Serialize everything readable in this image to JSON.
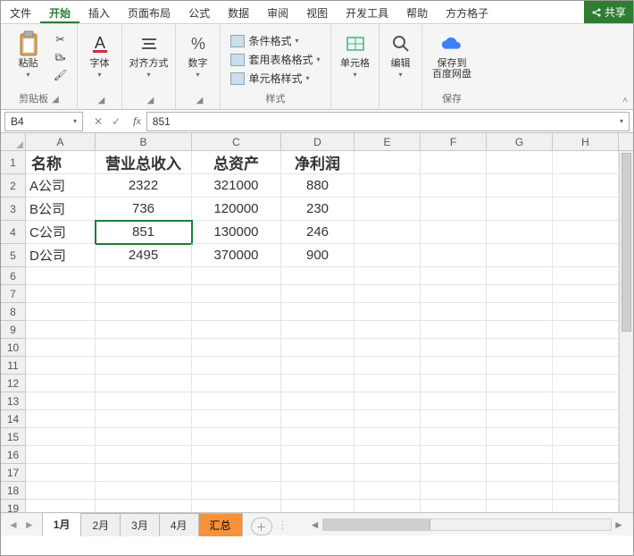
{
  "menu": {
    "items": [
      "文件",
      "开始",
      "插入",
      "页面布局",
      "公式",
      "数据",
      "审阅",
      "视图",
      "开发工具",
      "帮助",
      "方方格子"
    ],
    "active_index": 1,
    "share": "共享"
  },
  "ribbon": {
    "clipboard": {
      "paste": "粘贴",
      "label": "剪贴板"
    },
    "font": {
      "label": "字体",
      "btn": "字体"
    },
    "align": {
      "label": "",
      "btn": "对齐方式"
    },
    "number": {
      "label": "",
      "btn": "数字"
    },
    "styles": {
      "cond": "条件格式",
      "tablef": "套用表格格式",
      "cellf": "单元格样式",
      "label": "样式"
    },
    "cells": {
      "btn": "单元格"
    },
    "editing": {
      "btn": "编辑"
    },
    "save": {
      "btn": "保存到\n百度网盘",
      "label": "保存"
    }
  },
  "formula_bar": {
    "name_box": "B4",
    "value": "851"
  },
  "columns": [
    "A",
    "B",
    "C",
    "D",
    "E",
    "F",
    "G",
    "H"
  ],
  "row_numbers": [
    "1",
    "2",
    "3",
    "4",
    "5",
    "6",
    "7",
    "8",
    "9",
    "10",
    "11",
    "12",
    "13",
    "14",
    "15",
    "16",
    "17",
    "18",
    "19"
  ],
  "chart_data": {
    "type": "table",
    "headers": [
      "名称",
      "营业总收入",
      "总资产",
      "净利润"
    ],
    "rows": [
      {
        "name": "A公司",
        "rev": "2322",
        "assets": "321000",
        "profit": "880"
      },
      {
        "name": "B公司",
        "rev": "736",
        "assets": "120000",
        "profit": "230"
      },
      {
        "name": "C公司",
        "rev": "851",
        "assets": "130000",
        "profit": "246"
      },
      {
        "name": "D公司",
        "rev": "2495",
        "assets": "370000",
        "profit": "900"
      }
    ]
  },
  "active_cell": "B4",
  "sheets": {
    "tabs": [
      "1月",
      "2月",
      "3月",
      "4月",
      "汇总"
    ],
    "active_index": 0,
    "summary_index": 4
  }
}
